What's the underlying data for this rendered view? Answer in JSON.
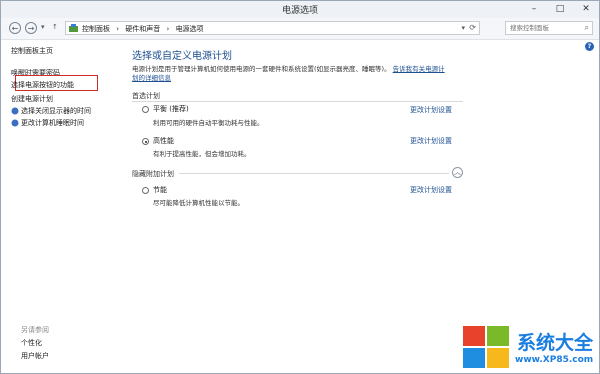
{
  "window": {
    "title": "电源选项"
  },
  "address": {
    "crumbs": [
      "控制面板",
      "›",
      "硬件和声音",
      "›",
      "电源选项"
    ],
    "search_placeholder": "搜索控制面板"
  },
  "sidebar": {
    "home": "控制面板主页",
    "items": [
      "唤醒时需要密码",
      "选择电源按钮的功能",
      "创建电源计划",
      "选择关闭显示器的时间",
      "更改计算机睡眠时间"
    ],
    "see_also_label": "另请参阅",
    "see_also": [
      "个性化",
      "用户帐户"
    ]
  },
  "main": {
    "heading": "选择或自定义电源计划",
    "description_line1": "电源计划是用于管理计算机如何使用电源的一套硬件和系统设置(如显示器亮度、睡眠等)。",
    "description_link_a": "告诉我有关电源计",
    "description_link_b": "划的详细信息",
    "preferred_label": "首选计划",
    "hidden_label": "隐藏附加计划",
    "change_link": "更改计划设置",
    "plans": [
      {
        "name": "平衡 (推荐)",
        "desc": "利用可用的硬件自动平衡功耗与性能。",
        "checked": false
      },
      {
        "name": "高性能",
        "desc": "有利于提高性能，但会增加功耗。",
        "checked": true
      },
      {
        "name": "节能",
        "desc": "尽可能降低计算机性能以节能。",
        "checked": false
      }
    ]
  },
  "watermark": {
    "brand": "系统大全",
    "url": "www.XP85.com"
  },
  "colors": {
    "link": "#1d4f91",
    "highlight_box": "#d12a2a",
    "brand": "#1a7ee0"
  }
}
